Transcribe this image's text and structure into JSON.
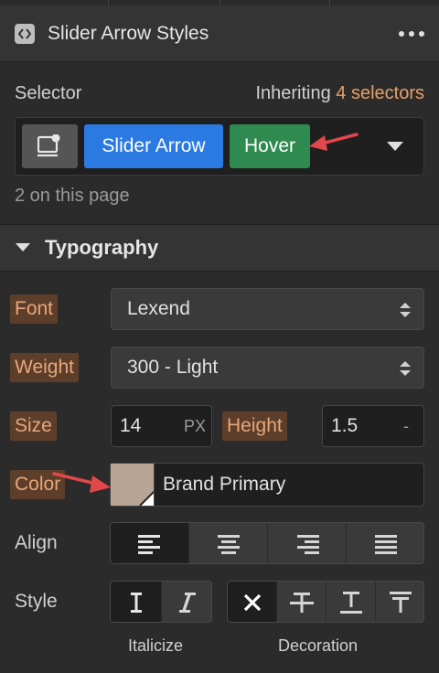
{
  "panel": {
    "title": "Slider Arrow Styles"
  },
  "selector": {
    "label": "Selector",
    "inherit_prefix": "Inheriting ",
    "inherit_count": "4 selectors",
    "chips": [
      "Slider Arrow",
      "Hover"
    ],
    "on_page": "2 on this page"
  },
  "typography": {
    "section_title": "Typography",
    "font_label": "Font",
    "font_value": "Lexend",
    "weight_label": "Weight",
    "weight_value": "300 - Light",
    "size_label": "Size",
    "size_value": "14",
    "size_unit": "PX",
    "height_label": "Height",
    "height_value": "1.5",
    "height_unit": "-",
    "color_label": "Color",
    "color_value": "Brand Primary",
    "color_hex": "#b9a596",
    "align_label": "Align",
    "style_label": "Style",
    "italicize_label": "Italicize",
    "decoration_label": "Decoration"
  },
  "colors": {
    "accent_blue": "#2a7ae2",
    "accent_green": "#2e8a4e",
    "highlight_text": "#e8a77a",
    "annotation_arrow": "#e2474b"
  }
}
